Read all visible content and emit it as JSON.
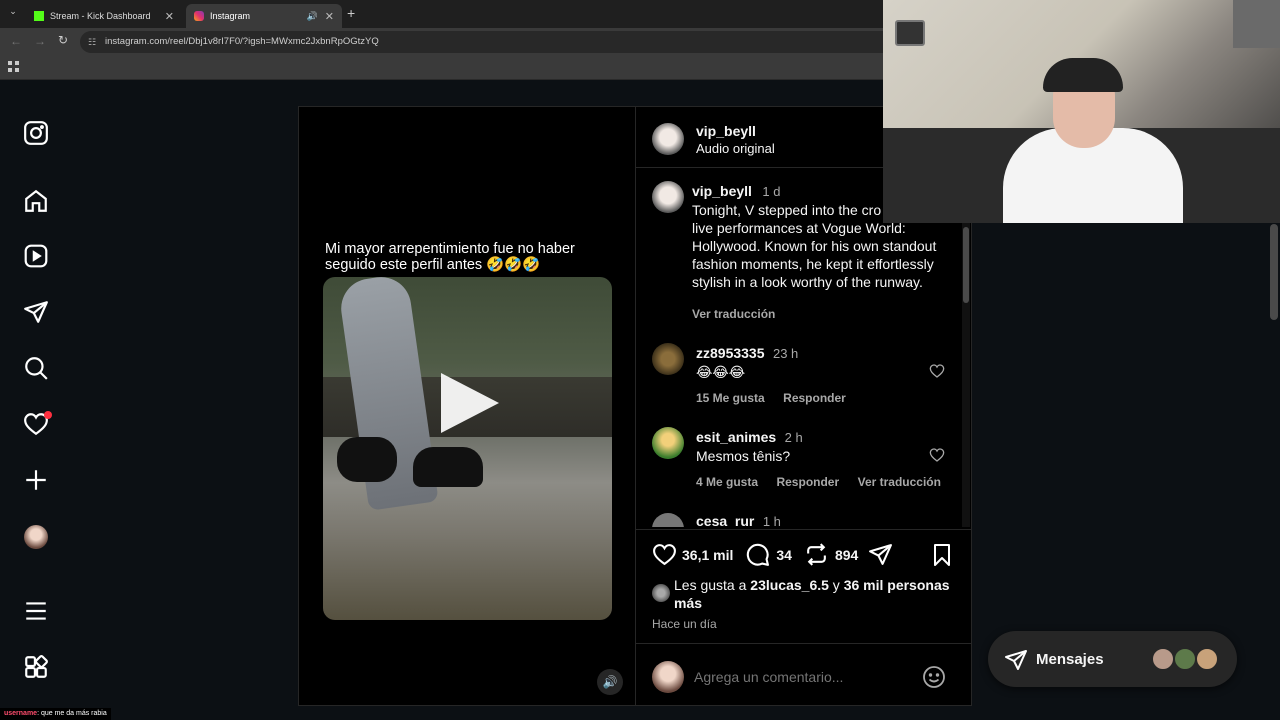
{
  "browser": {
    "tabs": [
      {
        "title": "Stream - Kick Dashboard"
      },
      {
        "title": "Instagram"
      }
    ],
    "url": "instagram.com/reel/Dbj1v8rI7F0/?igsh=MWxmc2JxbnRpOGtzYQ"
  },
  "reel": {
    "caption": "Mi mayor arrepentimiento fue no haber seguido este perfil antes 🤣🤣🤣"
  },
  "post": {
    "author": "vip_beyll",
    "audio": "Audio original",
    "caption_author": "vip_beyll",
    "caption_time": "1 d",
    "caption_text": "Tonight, V stepped into the cro taking in live performances at Vogue World: Hollywood. Known for his own standout fashion moments, he kept it effortlessly stylish in a look worthy of the runway.",
    "see_translation": "Ver traducción",
    "comments": [
      {
        "user": "zz8953335",
        "time": "23 h",
        "text": "😂😂😂",
        "likes": "15 Me gusta",
        "reply": "Responder",
        "translate": ""
      },
      {
        "user": "esit_animes",
        "time": "2 h",
        "text": "Mesmos tênis?",
        "likes": "4 Me gusta",
        "reply": "Responder",
        "translate": "Ver traducción"
      },
      {
        "user": "cesa_rur",
        "time": "1 h",
        "text": "",
        "likes": "",
        "reply": "",
        "translate": ""
      }
    ],
    "likes_count": "36,1 mil",
    "comments_count": "34",
    "reposts_count": "894",
    "liked_by_prefix": "Les gusta a ",
    "liked_by_user": "23lucas_6.5",
    "liked_by_mid": " y ",
    "liked_by_others": "36 mil personas",
    "liked_by_more": "más",
    "date": "Hace un día",
    "comment_placeholder": "Agrega un comentario..."
  },
  "messages": {
    "label": "Mensajes"
  },
  "chat": {
    "user": "username",
    "text": ": que me da más rabia"
  },
  "colors": {
    "accent": "#0095f6",
    "notif": "#ff3040",
    "kick": "#53fc18",
    "insta": "#e1306c"
  }
}
